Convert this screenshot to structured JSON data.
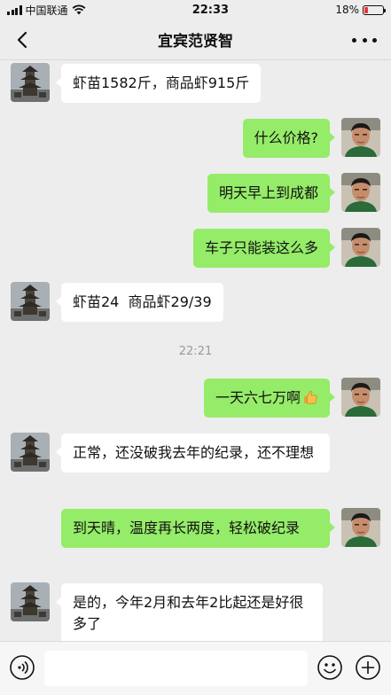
{
  "status_bar": {
    "carrier": "中国联通",
    "time": "22:33",
    "battery": "18%",
    "battery_level": 0.18
  },
  "header": {
    "title": "宜宾范贤智"
  },
  "messages": [
    {
      "side": "in",
      "text": "虾苗1582斤，商品虾915斤"
    },
    {
      "side": "out",
      "text": "什么价格?"
    },
    {
      "side": "out",
      "text": "明天早上到成都"
    },
    {
      "side": "out",
      "text": "车子只能装这么多"
    },
    {
      "side": "in",
      "text": "虾苗24  商品虾29/39"
    },
    {
      "side": "out",
      "text": "一天六七万啊",
      "icon": "thumbs-up-emoji"
    },
    {
      "side": "in",
      "text": "正常，还没破我去年的纪录，还不理想"
    },
    {
      "side": "out",
      "text": "到天晴，温度再长两度，轻松破纪录"
    },
    {
      "side": "in",
      "text": "是的，今年2月和去年2比起还是好很多了"
    }
  ],
  "time_separator": "22:21",
  "input_bar": {
    "placeholder": "",
    "icons": [
      "voice-icon",
      "emoji-icon",
      "plus-icon"
    ]
  },
  "colors": {
    "background": "#ededed",
    "outgoing_bubble": "#95ec69",
    "incoming_bubble": "#ffffff"
  }
}
